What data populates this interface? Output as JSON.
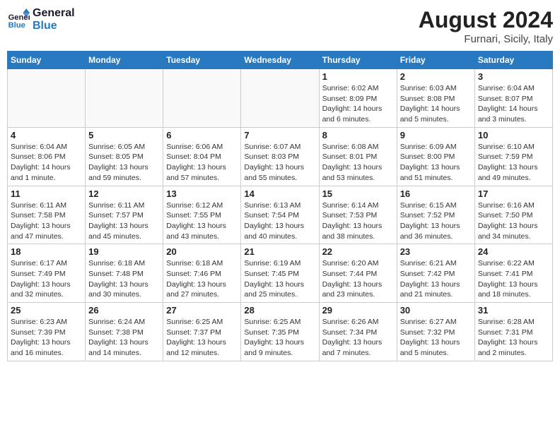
{
  "header": {
    "logo_line1": "General",
    "logo_line2": "Blue",
    "month_year": "August 2024",
    "location": "Furnari, Sicily, Italy"
  },
  "weekdays": [
    "Sunday",
    "Monday",
    "Tuesday",
    "Wednesday",
    "Thursday",
    "Friday",
    "Saturday"
  ],
  "weeks": [
    [
      {
        "day": "",
        "info": ""
      },
      {
        "day": "",
        "info": ""
      },
      {
        "day": "",
        "info": ""
      },
      {
        "day": "",
        "info": ""
      },
      {
        "day": "1",
        "info": "Sunrise: 6:02 AM\nSunset: 8:09 PM\nDaylight: 14 hours\nand 6 minutes."
      },
      {
        "day": "2",
        "info": "Sunrise: 6:03 AM\nSunset: 8:08 PM\nDaylight: 14 hours\nand 5 minutes."
      },
      {
        "day": "3",
        "info": "Sunrise: 6:04 AM\nSunset: 8:07 PM\nDaylight: 14 hours\nand 3 minutes."
      }
    ],
    [
      {
        "day": "4",
        "info": "Sunrise: 6:04 AM\nSunset: 8:06 PM\nDaylight: 14 hours\nand 1 minute."
      },
      {
        "day": "5",
        "info": "Sunrise: 6:05 AM\nSunset: 8:05 PM\nDaylight: 13 hours\nand 59 minutes."
      },
      {
        "day": "6",
        "info": "Sunrise: 6:06 AM\nSunset: 8:04 PM\nDaylight: 13 hours\nand 57 minutes."
      },
      {
        "day": "7",
        "info": "Sunrise: 6:07 AM\nSunset: 8:03 PM\nDaylight: 13 hours\nand 55 minutes."
      },
      {
        "day": "8",
        "info": "Sunrise: 6:08 AM\nSunset: 8:01 PM\nDaylight: 13 hours\nand 53 minutes."
      },
      {
        "day": "9",
        "info": "Sunrise: 6:09 AM\nSunset: 8:00 PM\nDaylight: 13 hours\nand 51 minutes."
      },
      {
        "day": "10",
        "info": "Sunrise: 6:10 AM\nSunset: 7:59 PM\nDaylight: 13 hours\nand 49 minutes."
      }
    ],
    [
      {
        "day": "11",
        "info": "Sunrise: 6:11 AM\nSunset: 7:58 PM\nDaylight: 13 hours\nand 47 minutes."
      },
      {
        "day": "12",
        "info": "Sunrise: 6:11 AM\nSunset: 7:57 PM\nDaylight: 13 hours\nand 45 minutes."
      },
      {
        "day": "13",
        "info": "Sunrise: 6:12 AM\nSunset: 7:55 PM\nDaylight: 13 hours\nand 43 minutes."
      },
      {
        "day": "14",
        "info": "Sunrise: 6:13 AM\nSunset: 7:54 PM\nDaylight: 13 hours\nand 40 minutes."
      },
      {
        "day": "15",
        "info": "Sunrise: 6:14 AM\nSunset: 7:53 PM\nDaylight: 13 hours\nand 38 minutes."
      },
      {
        "day": "16",
        "info": "Sunrise: 6:15 AM\nSunset: 7:52 PM\nDaylight: 13 hours\nand 36 minutes."
      },
      {
        "day": "17",
        "info": "Sunrise: 6:16 AM\nSunset: 7:50 PM\nDaylight: 13 hours\nand 34 minutes."
      }
    ],
    [
      {
        "day": "18",
        "info": "Sunrise: 6:17 AM\nSunset: 7:49 PM\nDaylight: 13 hours\nand 32 minutes."
      },
      {
        "day": "19",
        "info": "Sunrise: 6:18 AM\nSunset: 7:48 PM\nDaylight: 13 hours\nand 30 minutes."
      },
      {
        "day": "20",
        "info": "Sunrise: 6:18 AM\nSunset: 7:46 PM\nDaylight: 13 hours\nand 27 minutes."
      },
      {
        "day": "21",
        "info": "Sunrise: 6:19 AM\nSunset: 7:45 PM\nDaylight: 13 hours\nand 25 minutes."
      },
      {
        "day": "22",
        "info": "Sunrise: 6:20 AM\nSunset: 7:44 PM\nDaylight: 13 hours\nand 23 minutes."
      },
      {
        "day": "23",
        "info": "Sunrise: 6:21 AM\nSunset: 7:42 PM\nDaylight: 13 hours\nand 21 minutes."
      },
      {
        "day": "24",
        "info": "Sunrise: 6:22 AM\nSunset: 7:41 PM\nDaylight: 13 hours\nand 18 minutes."
      }
    ],
    [
      {
        "day": "25",
        "info": "Sunrise: 6:23 AM\nSunset: 7:39 PM\nDaylight: 13 hours\nand 16 minutes."
      },
      {
        "day": "26",
        "info": "Sunrise: 6:24 AM\nSunset: 7:38 PM\nDaylight: 13 hours\nand 14 minutes."
      },
      {
        "day": "27",
        "info": "Sunrise: 6:25 AM\nSunset: 7:37 PM\nDaylight: 13 hours\nand 12 minutes."
      },
      {
        "day": "28",
        "info": "Sunrise: 6:25 AM\nSunset: 7:35 PM\nDaylight: 13 hours\nand 9 minutes."
      },
      {
        "day": "29",
        "info": "Sunrise: 6:26 AM\nSunset: 7:34 PM\nDaylight: 13 hours\nand 7 minutes."
      },
      {
        "day": "30",
        "info": "Sunrise: 6:27 AM\nSunset: 7:32 PM\nDaylight: 13 hours\nand 5 minutes."
      },
      {
        "day": "31",
        "info": "Sunrise: 6:28 AM\nSunset: 7:31 PM\nDaylight: 13 hours\nand 2 minutes."
      }
    ]
  ]
}
